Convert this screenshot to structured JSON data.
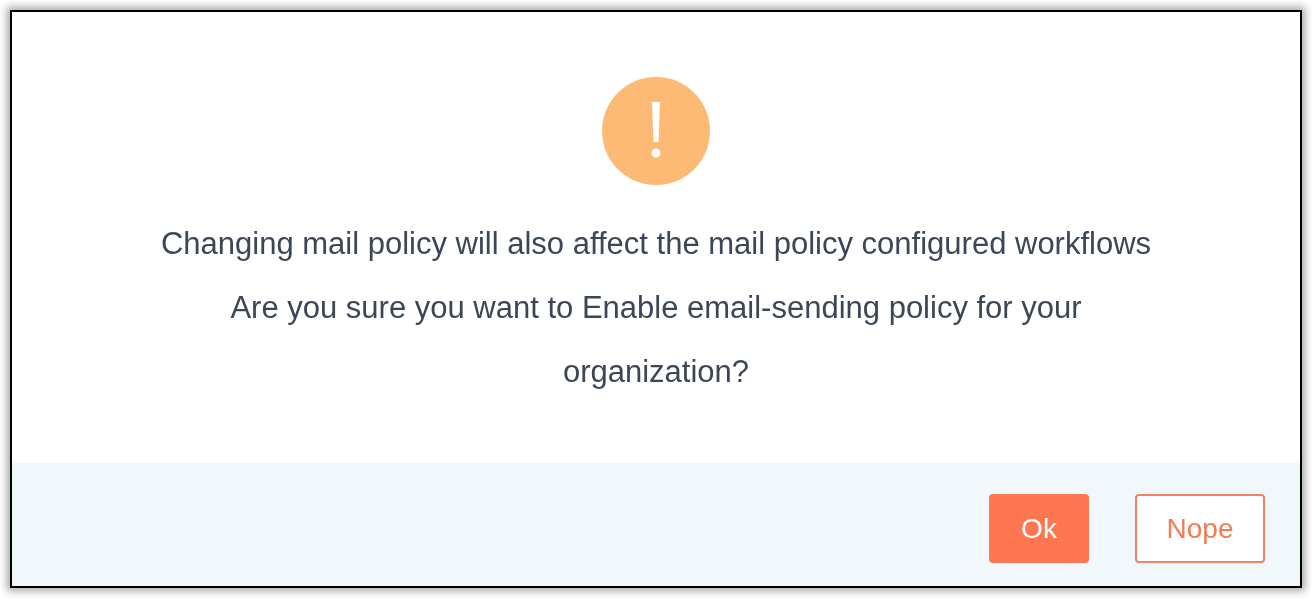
{
  "dialog": {
    "messages": [
      "Changing mail policy will also affect the mail policy configured workflows",
      "Are you sure you want to Enable email-sending policy for your organization?"
    ],
    "buttons": [
      {
        "label": "Ok",
        "kind": "primary"
      },
      {
        "label": "Nope",
        "kind": "secondary"
      }
    ]
  }
}
